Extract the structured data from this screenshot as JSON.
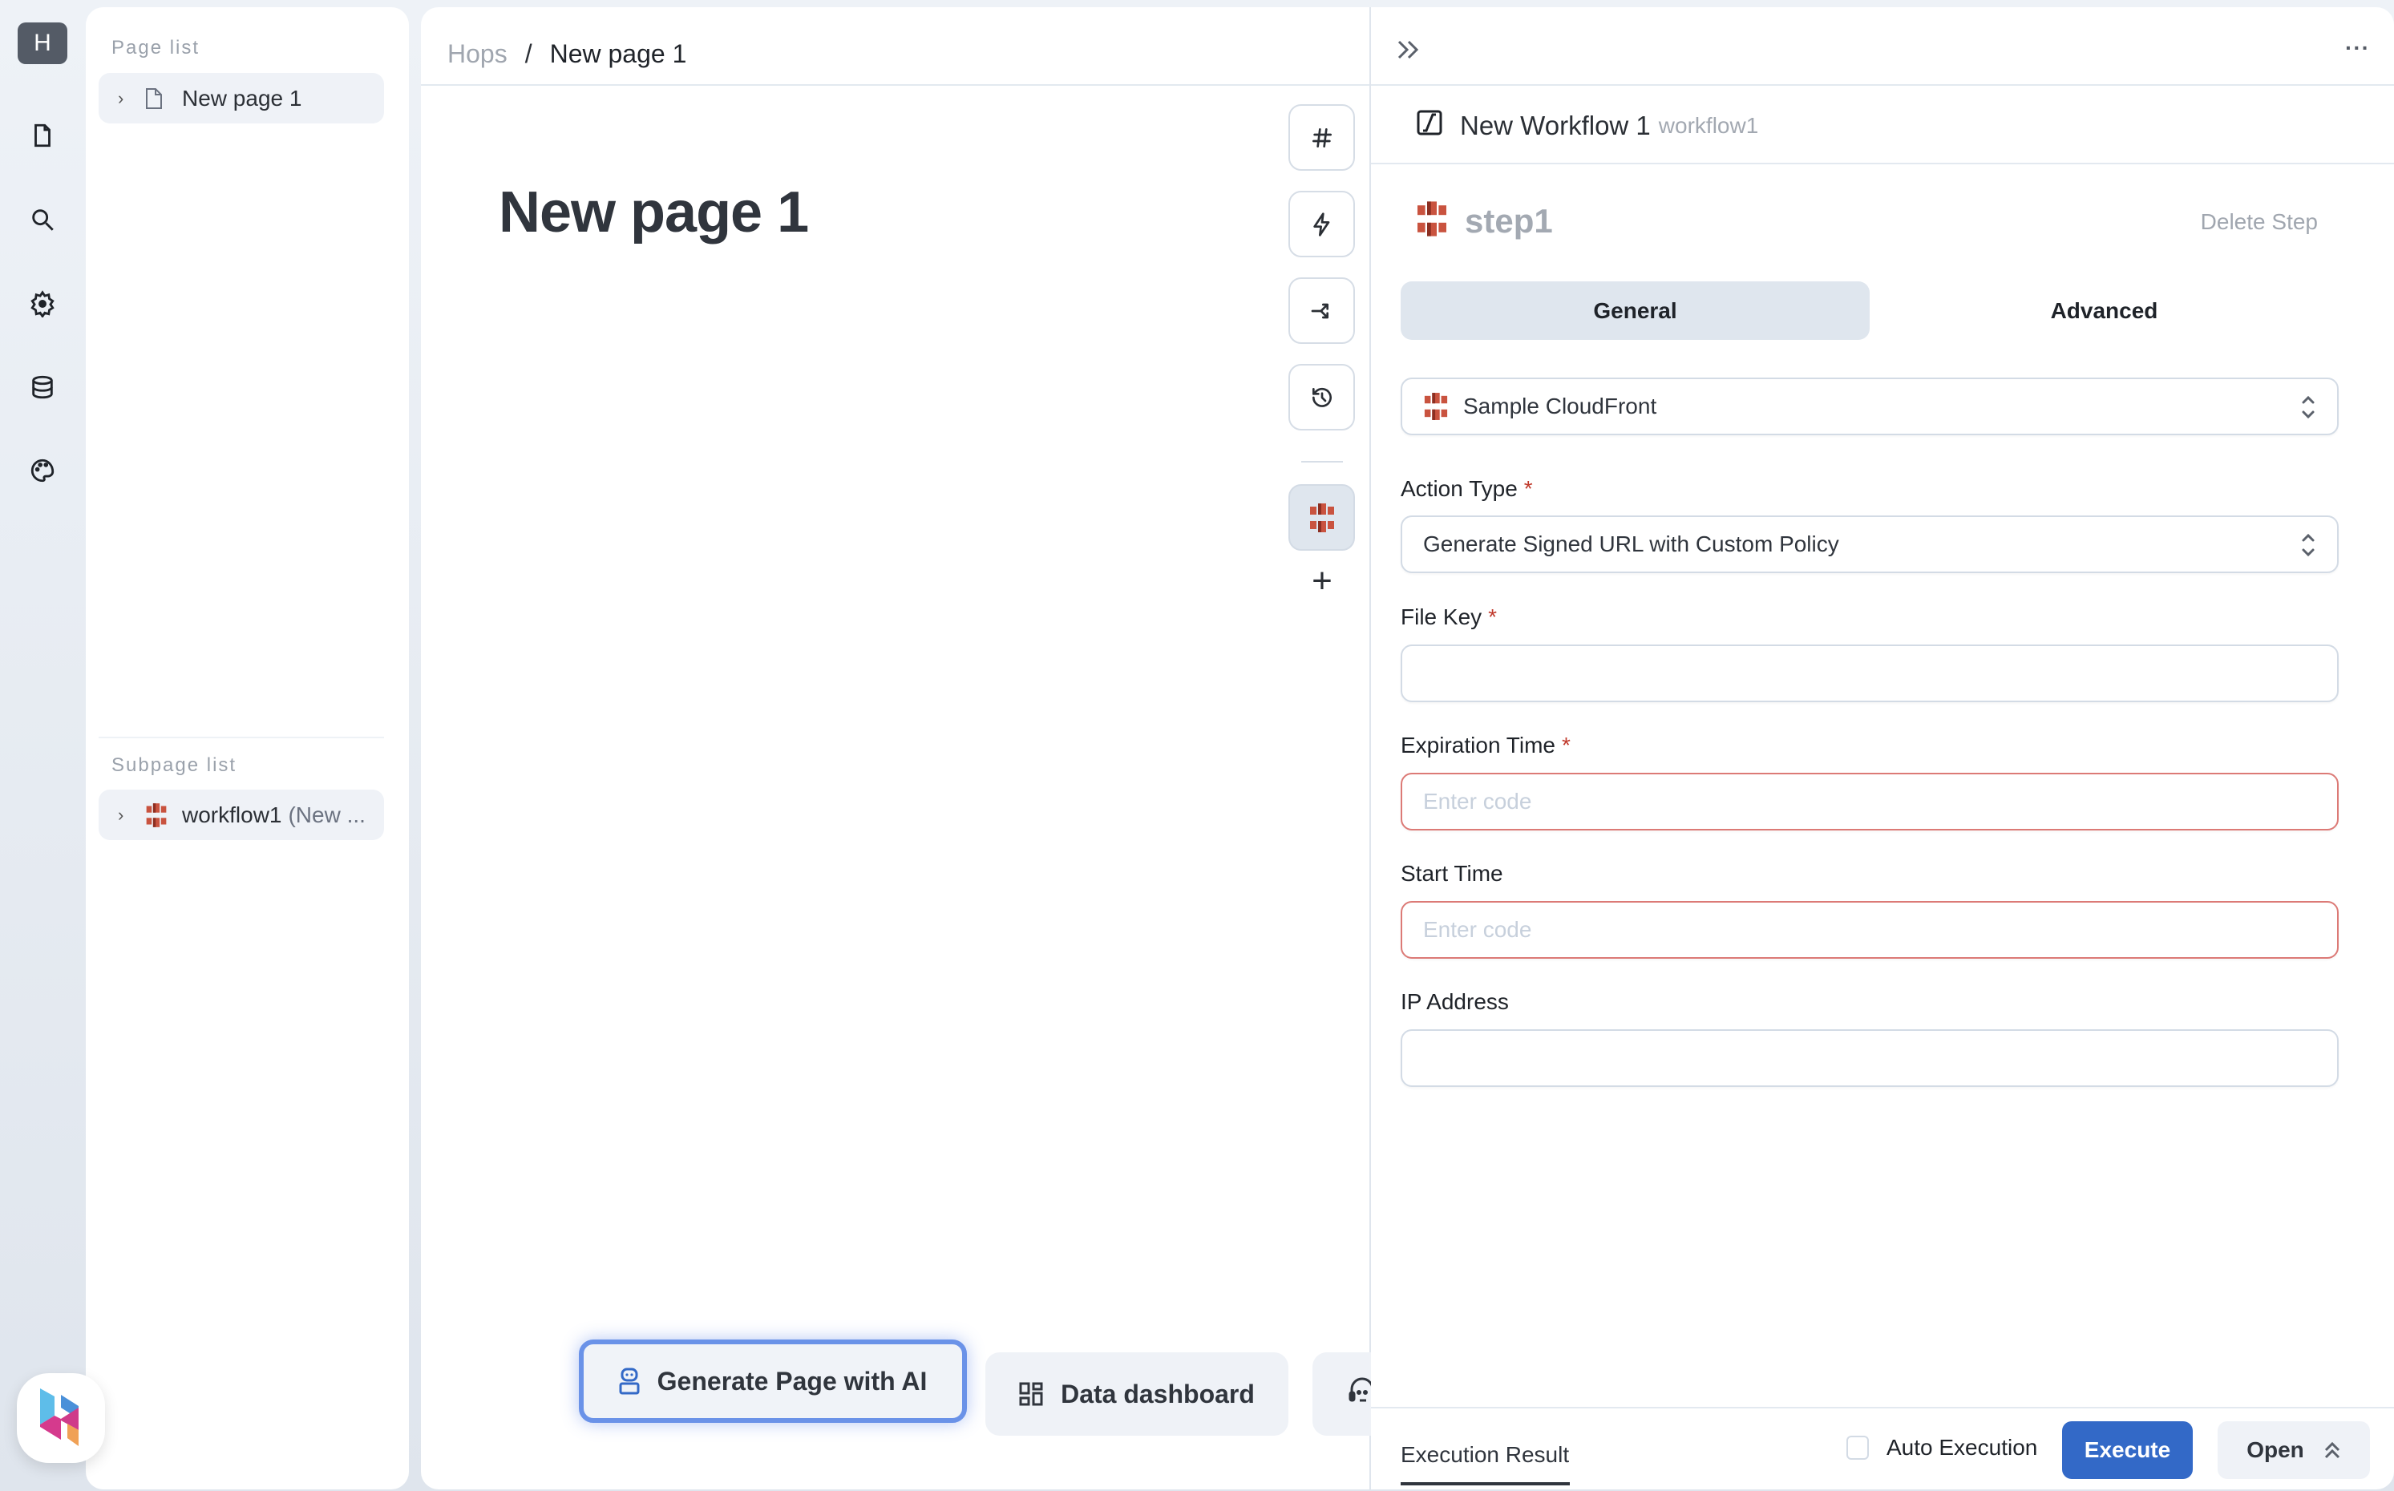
{
  "rail": {
    "avatar_letter": "H",
    "icons": [
      "page-icon",
      "search-icon",
      "gear-icon",
      "database-icon",
      "palette-icon"
    ],
    "logo": "hops-logo"
  },
  "page_list": {
    "title": "Page list",
    "items": [
      {
        "label": "New page 1",
        "icon": "file-icon"
      }
    ]
  },
  "subpage_list": {
    "title": "Subpage list",
    "items": [
      {
        "label": "workflow1",
        "suffix": "(New ...",
        "icon": "aws-cloudfront-icon"
      }
    ]
  },
  "breadcrumb": {
    "root": "Hops",
    "separator": "/",
    "current": "New page 1"
  },
  "page": {
    "title": "New page 1"
  },
  "tools": [
    "hash-icon",
    "lightning-icon",
    "branch-arrow-icon",
    "history-icon",
    "aws-cloudfront-icon",
    "plus-icon"
  ],
  "bottom_actions": [
    {
      "label": "Generate Page with AI",
      "icon": "robot-icon",
      "focused": true
    },
    {
      "label": "Data dashboard",
      "icon": "dashboard-grid-icon",
      "focused": false
    },
    {
      "label": "",
      "icon": "headset-icon",
      "focused": false
    }
  ],
  "workflow": {
    "name": "New Workflow 1",
    "id": "workflow1",
    "step": {
      "name": "step1",
      "delete_label": "Delete Step"
    },
    "tabs": [
      {
        "label": "General",
        "active": true
      },
      {
        "label": "Advanced",
        "active": false
      }
    ],
    "resource": {
      "value": "Sample CloudFront"
    },
    "fields": [
      {
        "label": "Action Type",
        "required": true,
        "type": "select",
        "value": "Generate Signed URL with Custom Policy",
        "placeholder": ""
      },
      {
        "label": "File Key",
        "required": true,
        "type": "text",
        "value": "",
        "placeholder": ""
      },
      {
        "label": "Expiration Time",
        "required": true,
        "type": "text",
        "value": "",
        "placeholder": "Enter code",
        "error": true
      },
      {
        "label": "Start Time",
        "required": false,
        "type": "text",
        "value": "",
        "placeholder": "Enter code",
        "error": true
      },
      {
        "label": "IP Address",
        "required": false,
        "type": "text",
        "value": "",
        "placeholder": ""
      }
    ],
    "required_marker": "*",
    "footer": {
      "result_tab": "Execution Result",
      "auto_execution_label": "Auto Execution",
      "auto_execution_checked": false,
      "execute_label": "Execute",
      "open_label": "Open"
    }
  },
  "colors": {
    "primary": "#3369c7",
    "error_border": "#dc7a76",
    "required": "#c0392b",
    "ai_focus": "#6a92e8",
    "aws_orange": "#d05c47"
  }
}
